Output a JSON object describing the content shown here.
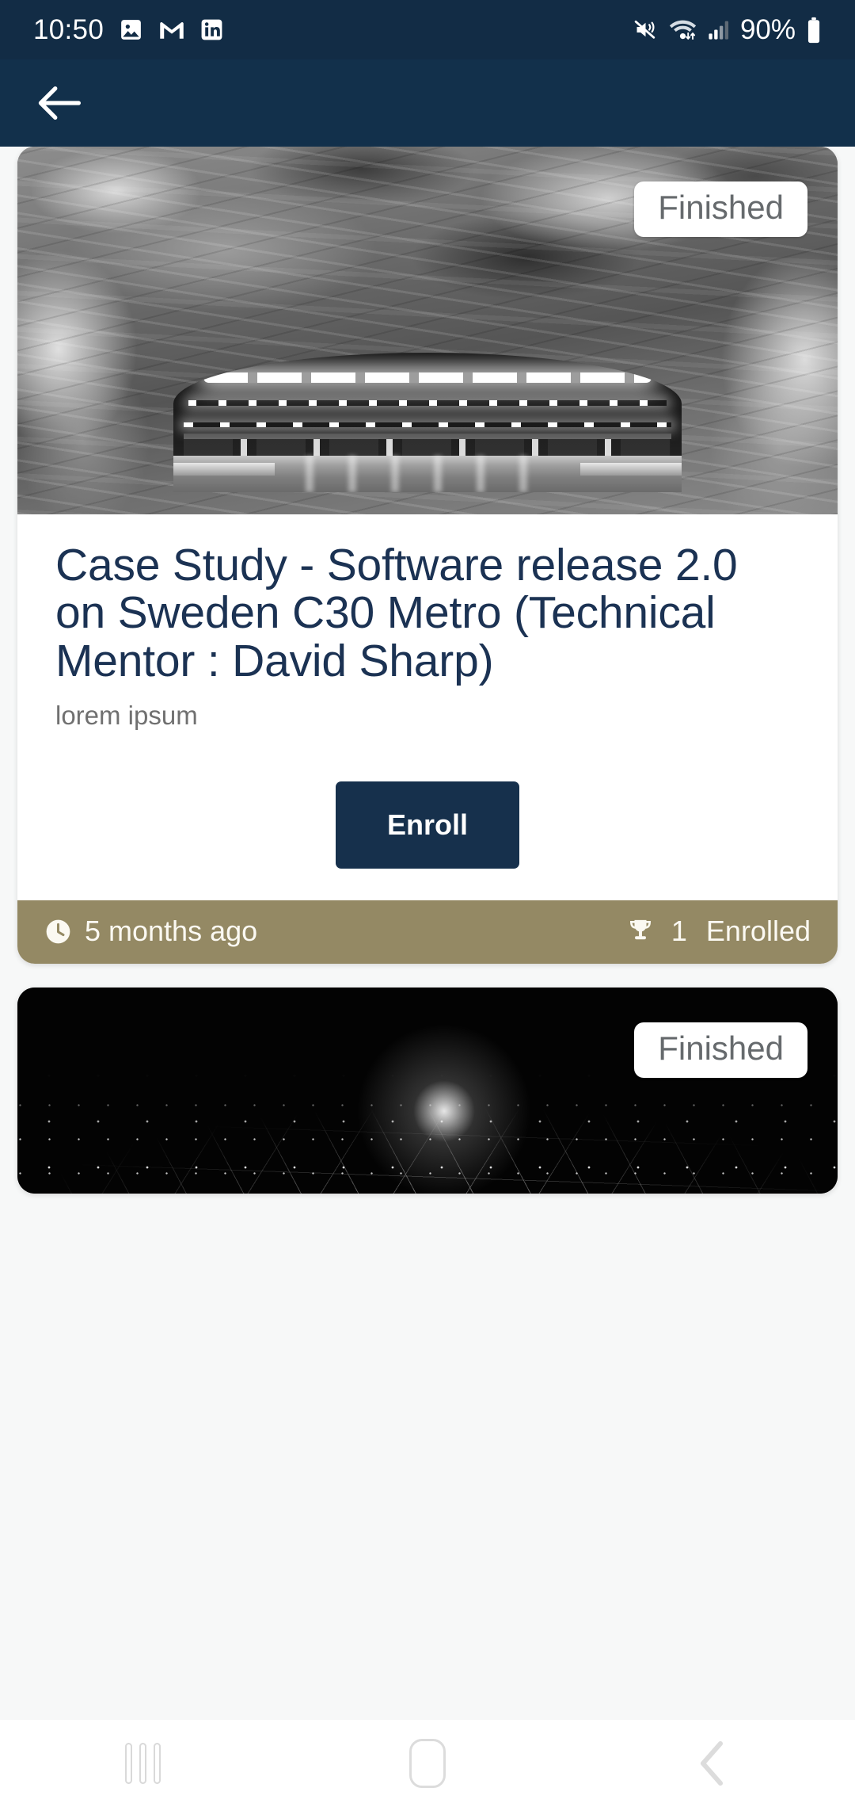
{
  "status_bar": {
    "time": "10:50",
    "battery_percent": "90%",
    "left_icons": [
      "photos-icon",
      "gmail-icon",
      "linkedin-icon"
    ],
    "right_icons": [
      "mute-vibrate-icon",
      "wifi-icon",
      "cellular-signal-icon",
      "battery-icon"
    ],
    "background_color": "#122c45"
  },
  "header": {
    "back_icon": "arrow-left-icon",
    "background_color": "#12304b"
  },
  "cards": [
    {
      "badge": "Finished",
      "title": "Case Study - Software release 2.0 on Sweden C30 Metro (Technical Mentor : David Sharp)",
      "subtitle": "lorem ipsum",
      "action_label": "Enroll",
      "time_icon": "clock-icon",
      "time_text": "5 months ago",
      "enrolled_icon": "trophy-icon",
      "enrolled_count": "1",
      "enrolled_label": "Enrolled",
      "banner_alt": "grayscale photo of rock cavern metro station platform with train",
      "footer_color": "#948964",
      "accent_color": "#16304c"
    },
    {
      "badge": "Finished",
      "banner_alt": "dark wireframe network graphic with light particles"
    }
  ],
  "nav_bar": {
    "recents_label": "recents-button",
    "home_label": "home-button",
    "back_label": "back-button"
  }
}
